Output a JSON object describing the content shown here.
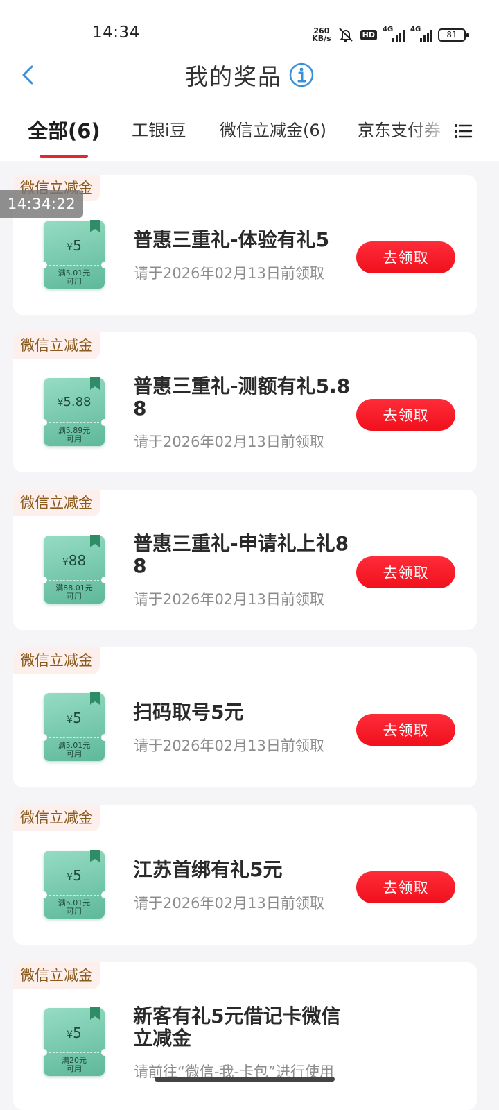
{
  "status_bar": {
    "time": "14:34",
    "speed_value": "260",
    "speed_unit": "KB/s",
    "hd_label": "HD",
    "network_1": "4G",
    "network_2": "4G",
    "battery": "81"
  },
  "header": {
    "title": "我的奖品",
    "back_icon": "chevron-left-icon",
    "info_icon": "info-circle-icon",
    "accent_color": "#3b8fd8"
  },
  "tabs": [
    {
      "label": "全部(6)",
      "active": true
    },
    {
      "label": "工银i豆",
      "active": false
    },
    {
      "label": "微信立减金(6)",
      "active": false
    },
    {
      "label": "京东支付券",
      "active": false
    }
  ],
  "menu_icon": "list-menu-icon",
  "overlay_timestamp": "14:34:22",
  "prizes": [
    {
      "tag": "微信立减金",
      "coupon_currency": "¥",
      "coupon_amount": "5",
      "coupon_condition": "满5.01元",
      "coupon_usable": "可用",
      "title": "普惠三重礼-体验有礼5",
      "desc": "请于2026年02月13日前领取",
      "button": "去领取"
    },
    {
      "tag": "微信立减金",
      "coupon_currency": "¥",
      "coupon_amount": "5.88",
      "coupon_condition": "满5.89元",
      "coupon_usable": "可用",
      "title": "普惠三重礼-测额有礼5.88",
      "desc": "请于2026年02月13日前领取",
      "button": "去领取"
    },
    {
      "tag": "微信立减金",
      "coupon_currency": "¥",
      "coupon_amount": "88",
      "coupon_condition": "满88.01元",
      "coupon_usable": "可用",
      "title": "普惠三重礼-申请礼上礼88",
      "desc": "请于2026年02月13日前领取",
      "button": "去领取"
    },
    {
      "tag": "微信立减金",
      "coupon_currency": "¥",
      "coupon_amount": "5",
      "coupon_condition": "满5.01元",
      "coupon_usable": "可用",
      "title": "扫码取号5元",
      "desc": "请于2026年02月13日前领取",
      "button": "去领取"
    },
    {
      "tag": "微信立减金",
      "coupon_currency": "¥",
      "coupon_amount": "5",
      "coupon_condition": "满5.01元",
      "coupon_usable": "可用",
      "title": "江苏首绑有礼5元",
      "desc": "请于2026年02月13日前领取",
      "button": "去领取"
    },
    {
      "tag": "微信立减金",
      "coupon_currency": "¥",
      "coupon_amount": "5",
      "coupon_condition": "满20元",
      "coupon_usable": "可用",
      "title": "新客有礼5元借记卡微信立减金",
      "desc": "请前往“微信-我-卡包”进行使用"
    }
  ],
  "colors": {
    "primary_red": "#e6262e",
    "coupon_green": "#5fb89b",
    "tag_text": "#8a5a1e",
    "tag_bg": "#fdf0ec"
  }
}
